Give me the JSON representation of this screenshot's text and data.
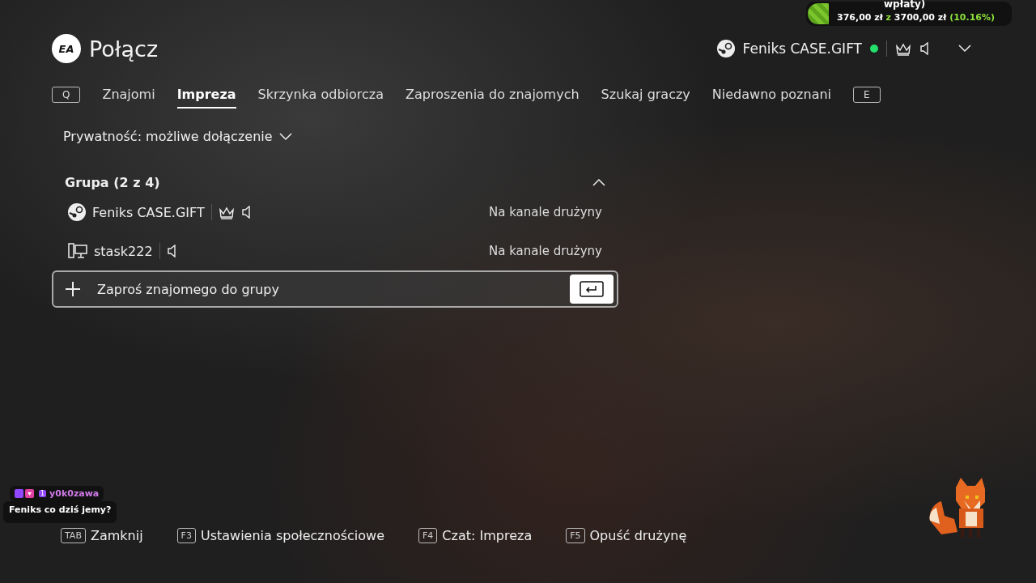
{
  "donation_goal": {
    "title": "wpłaty)",
    "raised": "376,00 zł",
    "separator": "z",
    "target": "3700,00 zł",
    "percent": "(10.16%)"
  },
  "header": {
    "logo": "EA",
    "title": "Połącz",
    "user": {
      "name": "Feniks CASE.GIFT",
      "online": true
    }
  },
  "tabs": {
    "prev_key": "Q",
    "next_key": "E",
    "items": [
      {
        "label": "Znajomi",
        "selected": false
      },
      {
        "label": "Impreza",
        "selected": true
      },
      {
        "label": "Skrzynka odbiorcza",
        "selected": false
      },
      {
        "label": "Zaproszenia do znajomych",
        "selected": false
      },
      {
        "label": "Szukaj graczy",
        "selected": false
      },
      {
        "label": "Niedawno poznani",
        "selected": false
      }
    ]
  },
  "privacy": {
    "label": "Prywatność: możliwe dołączenie"
  },
  "group": {
    "title": "Grupa (2 z 4)",
    "expanded": true,
    "members": [
      {
        "name": "Feniks CASE.GIFT",
        "kind": "steam",
        "leader": true,
        "status": "Na kanale drużyny"
      },
      {
        "name": "stask222",
        "kind": "pc",
        "leader": false,
        "status": "Na kanale drużyny"
      }
    ],
    "invite": {
      "label": "Zaproś znajomego do grupy"
    }
  },
  "footer": [
    {
      "key": "TAB",
      "label": "Zamknij"
    },
    {
      "key": "F3",
      "label": "Ustawienia społecznościowe"
    },
    {
      "key": "F4",
      "label": "Czat: Impreza"
    },
    {
      "key": "F5",
      "label": "Opuść drużynę"
    }
  ],
  "chat": {
    "user": "y0k0zawa",
    "badge": "1",
    "message": "Feniks co dziś jemy?"
  }
}
